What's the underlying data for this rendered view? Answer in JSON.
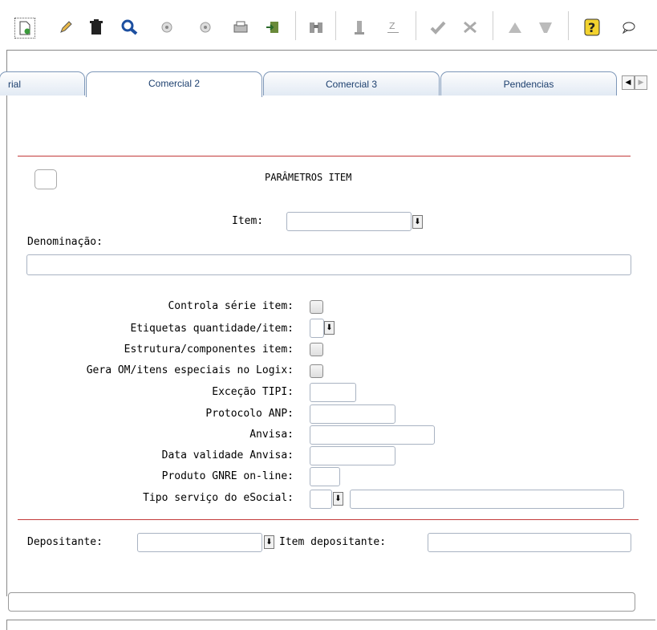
{
  "toolbar": {
    "icons": [
      "new-document-icon",
      "edit-pencil-icon",
      "delete-trash-icon",
      "search-magnifier-icon",
      "previous-record-icon",
      "next-record-icon",
      "print-icon",
      "exit-icon",
      "binoculars-icon",
      "first-record-icon",
      "last-record-icon",
      "confirm-check-icon",
      "cancel-x-icon",
      "up-arrow-icon",
      "filter-icon",
      "help-icon",
      "comment-icon"
    ]
  },
  "tabs": [
    {
      "label": "rial",
      "active": false
    },
    {
      "label": "Comercial 2",
      "active": true
    },
    {
      "label": "Comercial 3",
      "active": false
    },
    {
      "label": "Pendencias",
      "active": false
    }
  ],
  "section": {
    "title": "PARÂMETROS ITEM"
  },
  "form": {
    "item_label": "Item:",
    "item_value": "",
    "denominacao_label": "Denominação:",
    "denominacao_value": "",
    "fields": [
      {
        "label": "Controla série item:"
      },
      {
        "label": "Etiquetas quantidade/item:"
      },
      {
        "label": "Estrutura/componentes item:"
      },
      {
        "label": "Gera OM/itens especiais no Logix:"
      },
      {
        "label": "Exceção TIPI:"
      },
      {
        "label": "Protocolo ANP:"
      },
      {
        "label": "Anvisa:"
      },
      {
        "label": "Data validade Anvisa:"
      },
      {
        "label": "Produto GNRE on-line:"
      },
      {
        "label": "Tipo serviço do eSocial:"
      }
    ],
    "depositante_label": "Depositante:",
    "item_depositante_label": "Item depositante:"
  }
}
